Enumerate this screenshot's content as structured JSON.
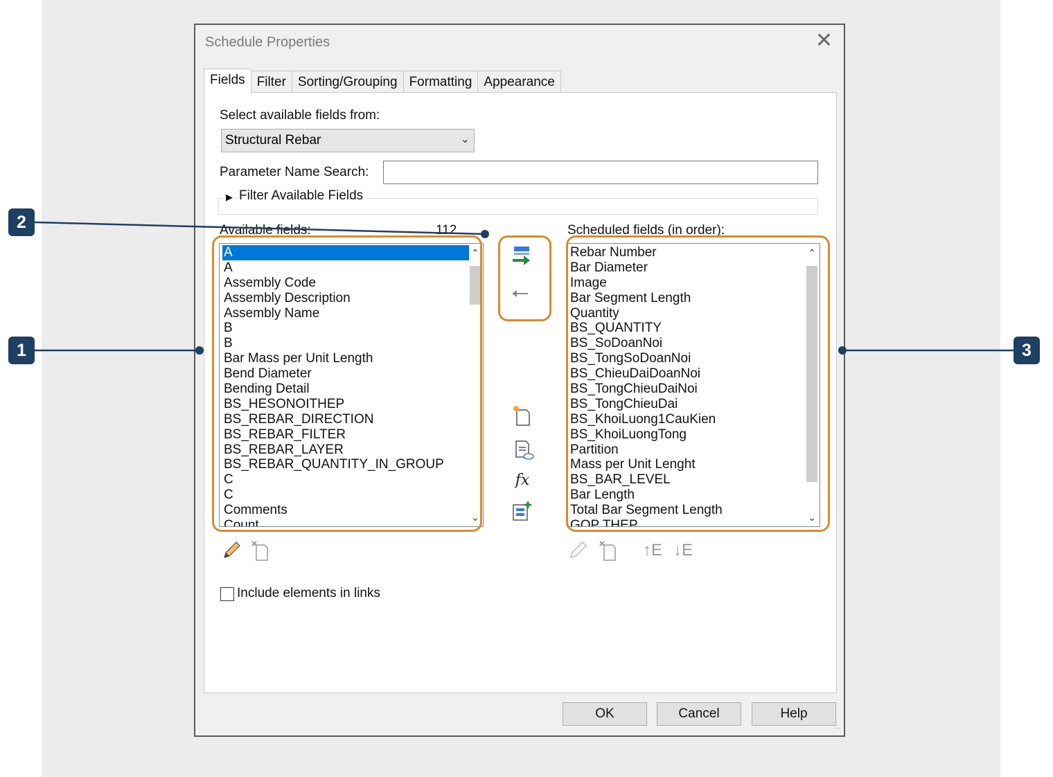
{
  "dialog": {
    "title": "Schedule Properties",
    "close_glyph": "✕",
    "tabs": [
      {
        "label": "Fields"
      },
      {
        "label": "Filter"
      },
      {
        "label": "Sorting/Grouping"
      },
      {
        "label": "Formatting"
      },
      {
        "label": "Appearance"
      }
    ],
    "active_tab": "Fields"
  },
  "fields_tab": {
    "select_label": "Select available fields from:",
    "category_value": "Structural Rebar",
    "search_label": "Parameter Name Search:",
    "search_value": "",
    "filter_label": "Filter Available Fields",
    "available_label": "Available fields:",
    "available_count": "112",
    "available_items": [
      "A",
      "A",
      "Assembly Code",
      "Assembly Description",
      "Assembly Name",
      "B",
      "B",
      "Bar Mass per Unit Length",
      "Bend Diameter",
      "Bending Detail",
      "BS_HESONOITHEP",
      "BS_REBAR_DIRECTION",
      "BS_REBAR_FILTER",
      "BS_REBAR_LAYER",
      "BS_REBAR_QUANTITY_IN_GROUP",
      "C",
      "C",
      "Comments",
      "Count"
    ],
    "available_selected_index": 0,
    "scheduled_label": "Scheduled fields (in order):",
    "scheduled_items": [
      "Rebar Number",
      "Bar Diameter",
      "Image",
      "Bar Segment Length",
      "Quantity",
      "BS_QUANTITY",
      "BS_SoDoanNoi",
      "BS_TongSoDoanNoi",
      "BS_ChieuDaiDoanNoi",
      "BS_TongChieuDaiNoi",
      "BS_TongChieuDai",
      "BS_KhoiLuong1CauKien",
      "BS_KhoiLuongTong",
      "Partition",
      "Mass per Unit Lenght",
      "BS_BAR_LEVEL",
      "Bar Length",
      "Total Bar Segment Length",
      "GOP THEP"
    ],
    "include_links_label": "Include elements in links",
    "include_links_checked": false,
    "sort_up_label": "↑E",
    "sort_down_label": "↓E",
    "fx_label": "fx"
  },
  "buttons": {
    "ok": "OK",
    "cancel": "Cancel",
    "help": "Help"
  },
  "callouts": [
    {
      "label": "1"
    },
    {
      "label": "2"
    },
    {
      "label": "3"
    }
  ],
  "colors": {
    "selection": "#0078d7",
    "callout_badge": "#1f3f63",
    "highlight_outline": "#d98a2e",
    "add_arrow": "#2e8b3a"
  }
}
